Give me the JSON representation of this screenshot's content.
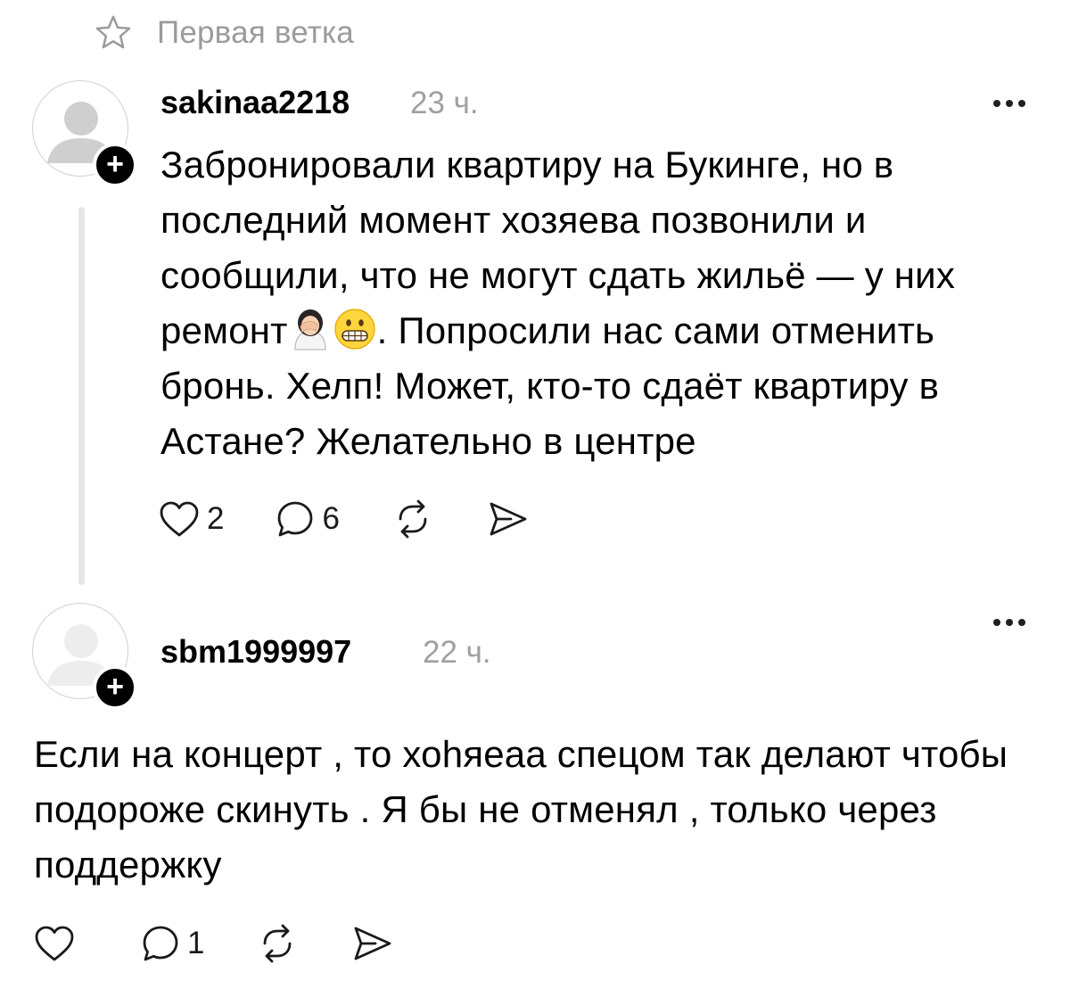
{
  "thread": {
    "title": "Первая ветка"
  },
  "posts": [
    {
      "username": "sakinaa2218",
      "time": "23 ч.",
      "text_before_emoji": "Забронировали квартиру на Букинге, но в последний момент хозяева позвонили и сообщили, что не могут сдать жильё — у них ремонт",
      "emojis": [
        "woman-facepalming",
        "grimacing-face"
      ],
      "text_after_emoji": ". Попросили нас сами отменить бронь. Хелп! Может, кто-то сдаёт квартиру в Астане? Желательно в центре",
      "likes": "2",
      "comments": "6"
    },
    {
      "username": "sbm1999997",
      "time": "22 ч.",
      "text": "Если на концерт , то хоһяеаа спецом так делают чтобы подороже скинуть . Я бы не отменял , только через поддержку",
      "likes": "",
      "comments": "1"
    }
  ]
}
